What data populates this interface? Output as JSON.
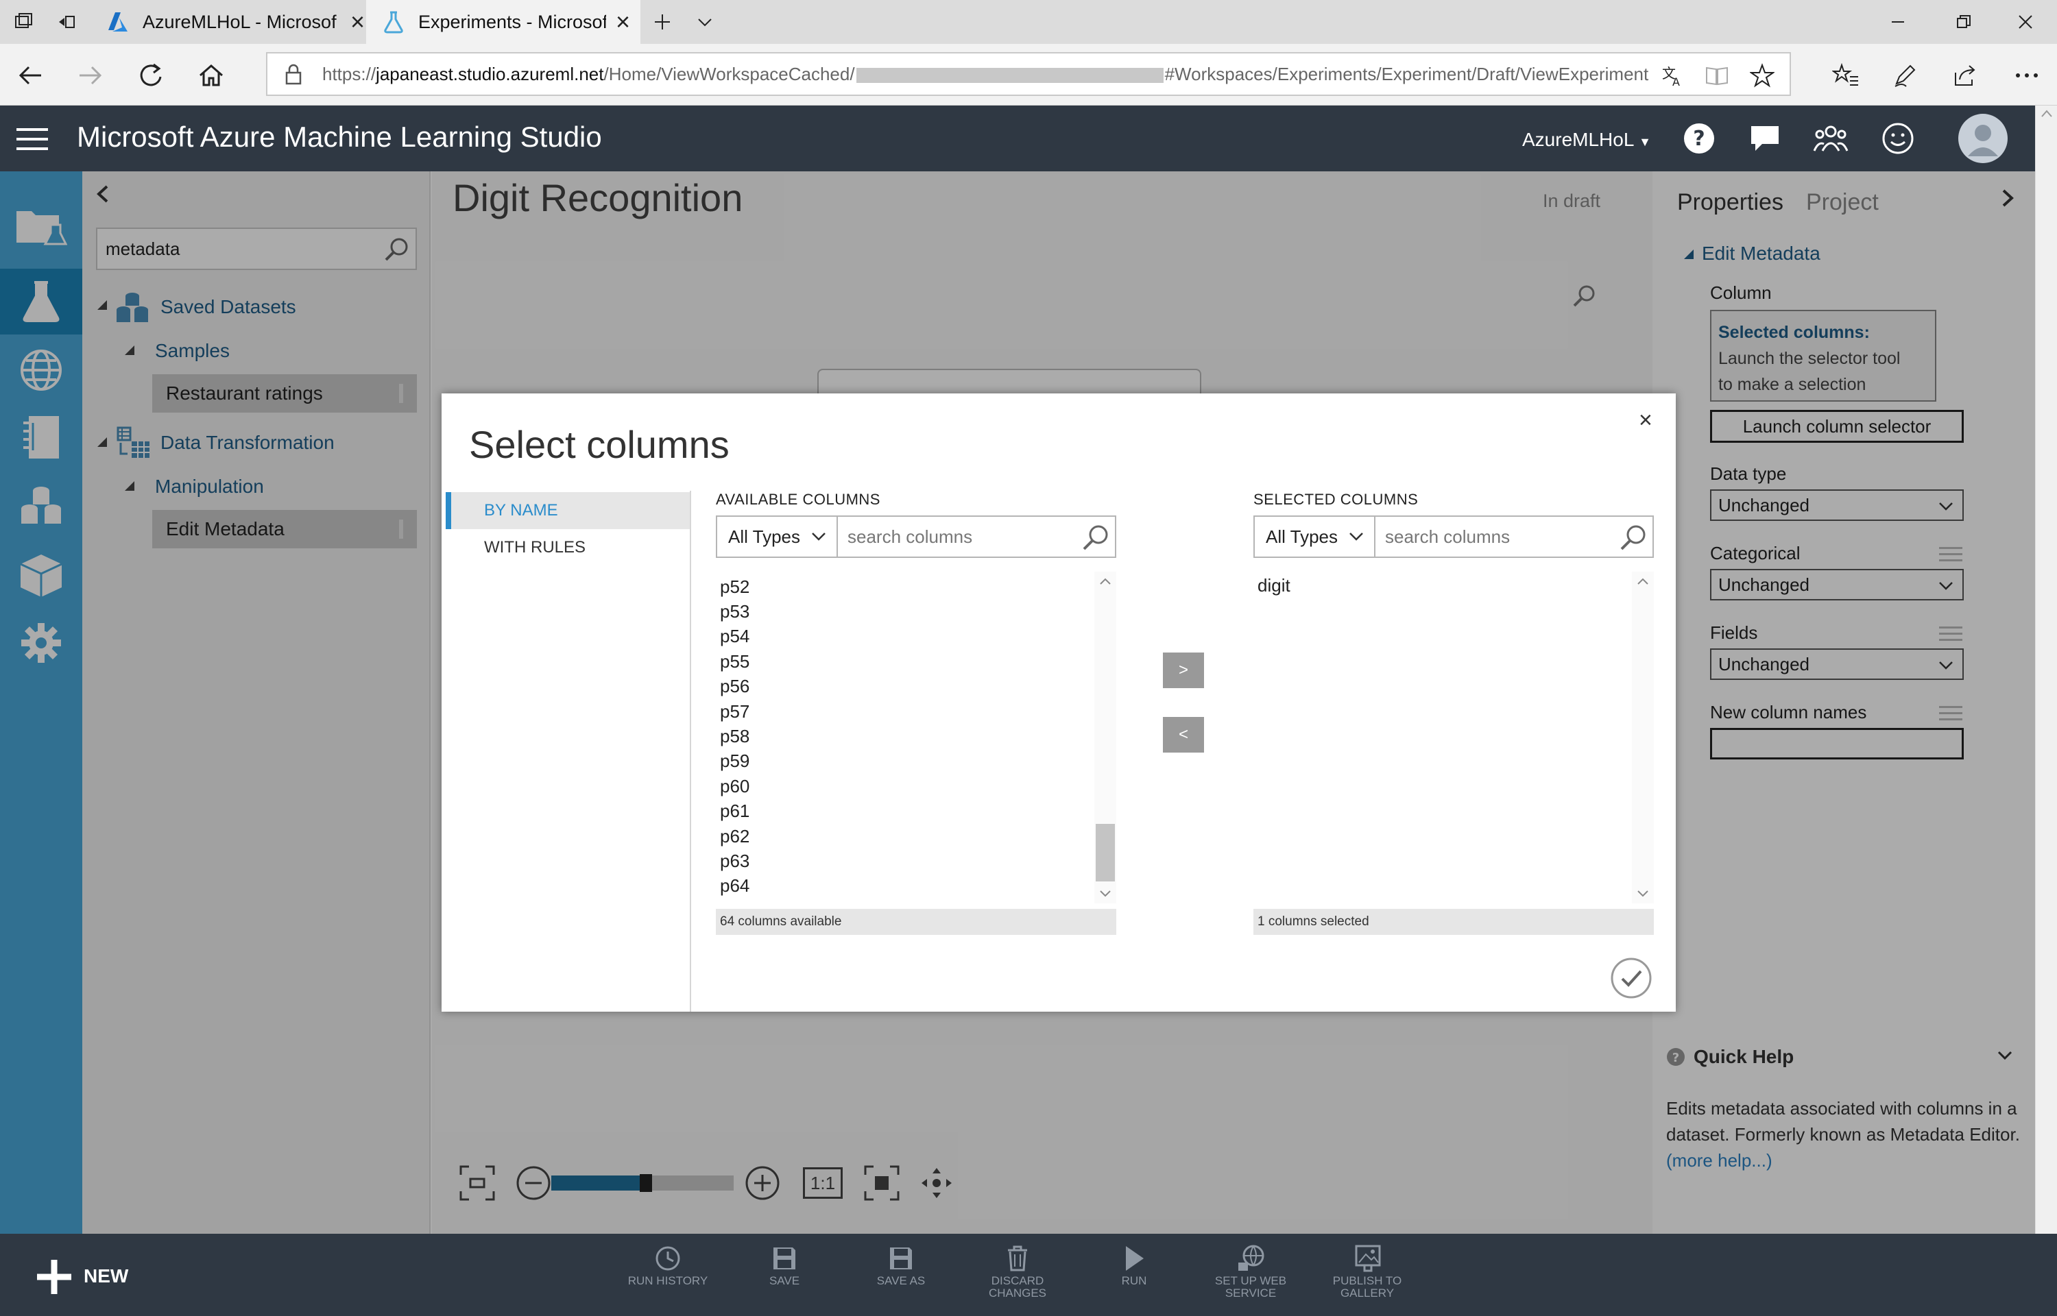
{
  "browser": {
    "tabs": [
      {
        "label": "AzureMLHoL - Microsof",
        "active": false
      },
      {
        "label": "Experiments - Microsoft",
        "active": true
      }
    ],
    "url": {
      "prefix": "https://",
      "host": "japaneast.studio.azureml.net",
      "path": "/Home/ViewWorkspaceCached/",
      "suffix": "#Workspaces/Experiments/Experiment/Draft/ViewExperiment"
    }
  },
  "app": {
    "title": "Microsoft Azure Machine Learning Studio",
    "account": "AzureMLHoL",
    "brand_color": "#2f3843",
    "accent_color": "#4aa7d9"
  },
  "palette": {
    "search_value": "metadata",
    "tree": {
      "saved_datasets": "Saved Datasets",
      "samples": "Samples",
      "restaurant_ratings": "Restaurant ratings",
      "data_transformation": "Data Transformation",
      "manipulation": "Manipulation",
      "edit_metadata": "Edit Metadata"
    }
  },
  "canvas": {
    "experiment_title": "Digit Recognition",
    "status": "In draft"
  },
  "properties": {
    "tab_properties": "Properties",
    "tab_project": "Project",
    "module_name": "Edit Metadata",
    "column_label": "Column",
    "selected_columns_heading": "Selected columns:",
    "selected_columns_text_1": "Launch the selector tool",
    "selected_columns_text_2": "to make a selection",
    "launch_button": "Launch column selector",
    "data_type_label": "Data type",
    "data_type_value": "Unchanged",
    "categorical_label": "Categorical",
    "categorical_value": "Unchanged",
    "fields_label": "Fields",
    "fields_value": "Unchanged",
    "new_column_names_label": "New column names",
    "new_column_names_value": ""
  },
  "quick_help": {
    "title": "Quick Help",
    "text_1": "Edits metadata associated with columns in a",
    "text_2": "dataset. Formerly known as Metadata Editor.",
    "link": "(more help...)"
  },
  "modal": {
    "title": "Select columns",
    "close": "×",
    "tabs": [
      "BY NAME",
      "WITH RULES"
    ],
    "available": {
      "header": "AVAILABLE COLUMNS",
      "type_filter": "All Types",
      "search_placeholder": "search columns",
      "items": [
        "p52",
        "p53",
        "p54",
        "p55",
        "p56",
        "p57",
        "p58",
        "p59",
        "p60",
        "p61",
        "p62",
        "p63",
        "p64"
      ],
      "status": "64 columns available"
    },
    "selected": {
      "header": "SELECTED COLUMNS",
      "type_filter": "All Types",
      "search_placeholder": "search columns",
      "items": [
        "digit"
      ],
      "status": "1 columns selected"
    },
    "add_button": ">",
    "remove_button": "<"
  },
  "zoom": {
    "one_to_one": "1:1",
    "level_fraction": 0.5
  },
  "bottom_actions": [
    {
      "label": "RUN HISTORY",
      "icon": "clock-icon"
    },
    {
      "label": "SAVE",
      "icon": "save-icon"
    },
    {
      "label": "SAVE AS",
      "icon": "save-as-icon"
    },
    {
      "label": "DISCARD CHANGES",
      "icon": "trash-icon"
    },
    {
      "label": "RUN",
      "icon": "play-icon"
    },
    {
      "label": "SET UP WEB SERVICE",
      "icon": "web-service-icon"
    },
    {
      "label": "PUBLISH TO GALLERY",
      "icon": "gallery-icon"
    }
  ],
  "new_button": "NEW"
}
